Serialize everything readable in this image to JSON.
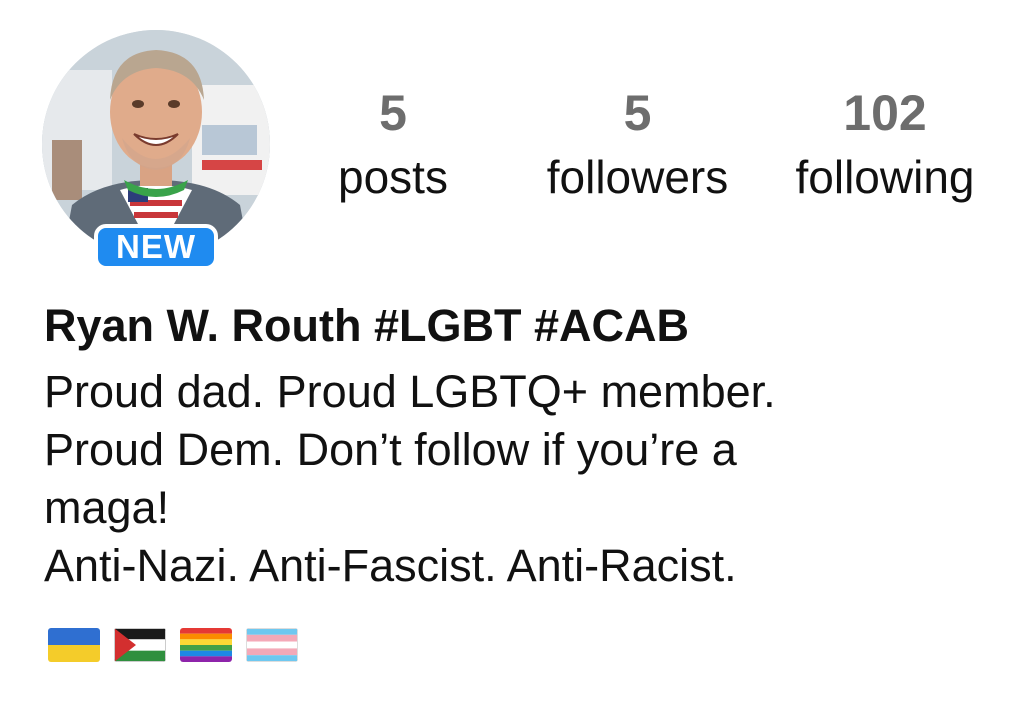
{
  "profile": {
    "name_line": "Ryan W. Routh #LGBT #ACAB",
    "new_badge": "NEW",
    "avatar_icon": "profile-photo"
  },
  "stats": {
    "posts": {
      "value": "5",
      "label": "posts"
    },
    "followers": {
      "value": "5",
      "label": "followers"
    },
    "following": {
      "value": "102",
      "label": "following"
    }
  },
  "bio": {
    "lines": [
      "Proud dad. Proud LGBTQ+ member.",
      "Proud Dem. Don’t follow if you’re a",
      "maga!",
      "Anti-Nazi. Anti-Fascist. Anti-Racist."
    ],
    "flags": [
      "ukraine-flag-icon",
      "palestine-flag-icon",
      "rainbow-flag-icon",
      "transgender-flag-icon"
    ]
  },
  "colors": {
    "badge_blue": "#1f8bf0",
    "stat_number_gray": "#6d6d6d",
    "text": "#111111"
  }
}
